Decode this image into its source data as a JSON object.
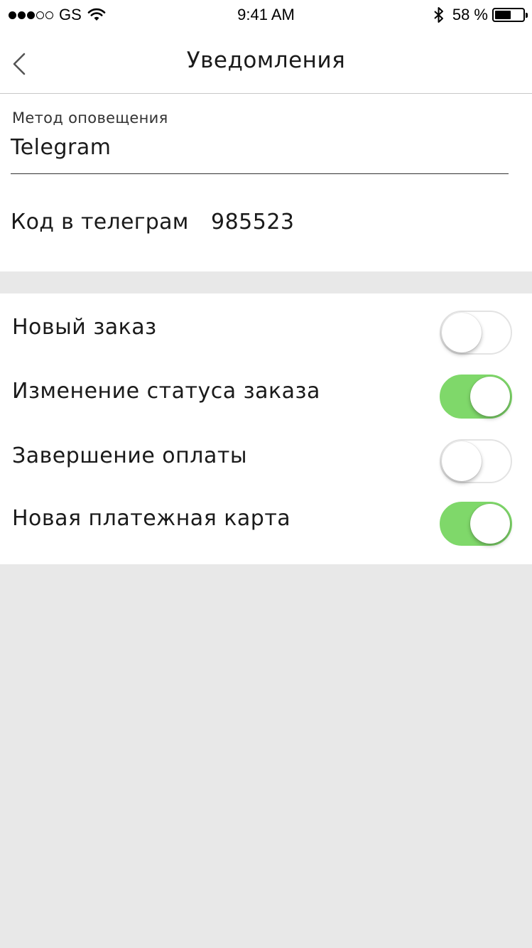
{
  "status_bar": {
    "carrier": "GS",
    "time": "9:41 AM",
    "battery_text": "58 %",
    "battery_level": 0.58,
    "signal_icon": "signal-dots-icon",
    "wifi_icon": "wifi-icon",
    "bluetooth_icon": "bluetooth-icon"
  },
  "nav": {
    "title": "Уведомления",
    "back_icon": "chevron-left-icon"
  },
  "notification_method": {
    "caption": "Метод оповещения",
    "value": "Telegram"
  },
  "telegram_code": {
    "label": "Код в телеграм",
    "value": "985523"
  },
  "toggles": [
    {
      "label": "Новый заказ",
      "on": false
    },
    {
      "label": "Изменение статуса заказа",
      "on": true
    },
    {
      "label": "Завершение оплаты",
      "on": false
    },
    {
      "label": "Новая платежная карта",
      "on": true
    }
  ],
  "colors": {
    "switch_on": "#7fd86a",
    "background": "#e8e8e8",
    "surface": "#ffffff"
  }
}
